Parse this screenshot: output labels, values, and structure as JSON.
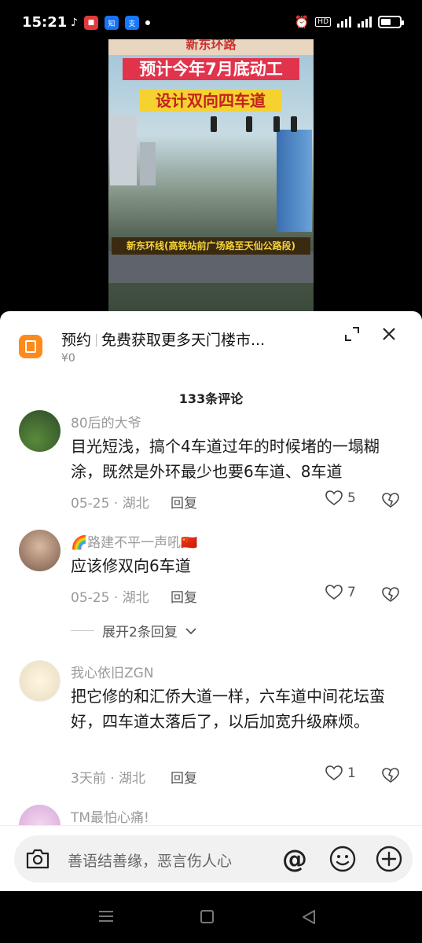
{
  "status_bar": {
    "time": "15:21",
    "battery_level": 0.55
  },
  "video": {
    "banner_top": "新东环路",
    "banner_line1": "预计今年7月底动工",
    "banner_line2": "设计双向四车道",
    "caption": "新东环线(高铁站前广场路至天仙公路段)"
  },
  "ad": {
    "label": "预约",
    "title": "免费获取更多天门楼市...",
    "price": "¥0"
  },
  "comments_header": {
    "count_label": "133条评论"
  },
  "comments": [
    {
      "name": "80后的大爷",
      "text": "目光短浅，搞个4车道过年的时候堵的一塌糊涂，既然是外环最少也要6车道、8车道",
      "meta": "05-25 · 湖北",
      "reply_label": "回复",
      "likes": "5"
    },
    {
      "name": "🌈路建不平一声吼🇨🇳",
      "text": "应该修双向6车道",
      "meta": "05-25 · 湖北",
      "reply_label": "回复",
      "likes": "7",
      "expand_label": "展开2条回复"
    },
    {
      "name": "我心依旧ZGN",
      "text": "把它修的和汇侨大道一样，六车道中间花坛蛮好，四车道太落后了，以后加宽升级麻烦。",
      "meta": "3天前 · 湖北",
      "reply_label": "回复",
      "likes": "1"
    },
    {
      "name": "TM最怕心痛!"
    }
  ],
  "input_bar": {
    "placeholder": "善语结善缘，恶言伤人心",
    "at_symbol": "@"
  },
  "icons": {
    "accent_orange": "#ff8a1c"
  }
}
